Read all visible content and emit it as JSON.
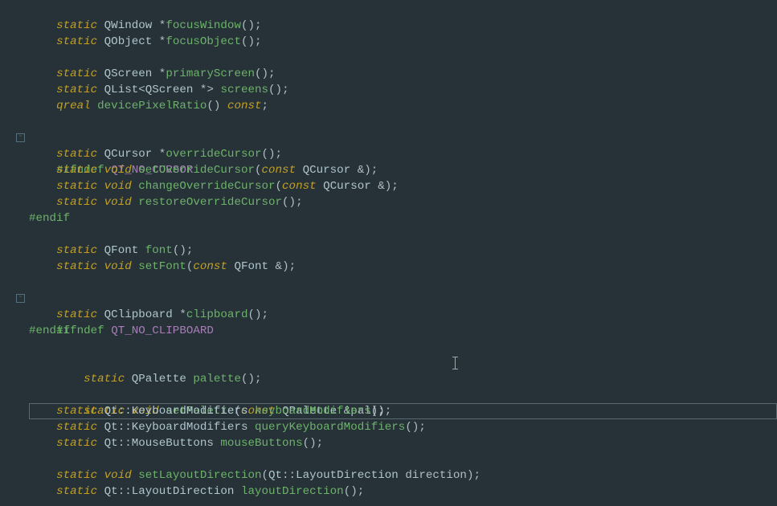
{
  "tokens": {
    "static": "static",
    "void": "void",
    "const": "const",
    "qreal": "qreal",
    "ifndef": "#ifndef",
    "endif": "#endif"
  },
  "types": {
    "QWindow": "QWindow",
    "QObject": "QObject",
    "QScreen": "QScreen",
    "QList": "QList",
    "QCursor": "QCursor",
    "QFont": "QFont",
    "QClipboard": "QClipboard",
    "QPalette": "QPalette",
    "Qt": "Qt",
    "KeyboardModifiers": "KeyboardModifiers",
    "MouseButtons": "MouseButtons",
    "LayoutDirection": "LayoutDirection"
  },
  "macros": {
    "no_cursor": "QT_NO_CURSOR",
    "no_clipboard": "QT_NO_CLIPBOARD"
  },
  "fns": {
    "focusWindow": "focusWindow",
    "focusObject": "focusObject",
    "primaryScreen": "primaryScreen",
    "screens": "screens",
    "devicePixelRatio": "devicePixelRatio",
    "overrideCursor": "overrideCursor",
    "setOverrideCursor": "setOverrideCursor",
    "changeOverrideCursor": "changeOverrideCursor",
    "restoreOverrideCursor": "restoreOverrideCursor",
    "font": "font",
    "setFont": "setFont",
    "clipboard": "clipboard",
    "palette": "palette",
    "setPalette": "setPalette",
    "keyboardModifiers": "keyboardModifiers",
    "queryKeyboardModifiers": "queryKeyboardModifiers",
    "mouseButtons": "mouseButtons",
    "setLayoutDirection": "setLayoutDirection",
    "layoutDirection": "layoutDirection"
  },
  "params": {
    "pal": "pal",
    "direction": "direction"
  },
  "fold_symbol": "-"
}
